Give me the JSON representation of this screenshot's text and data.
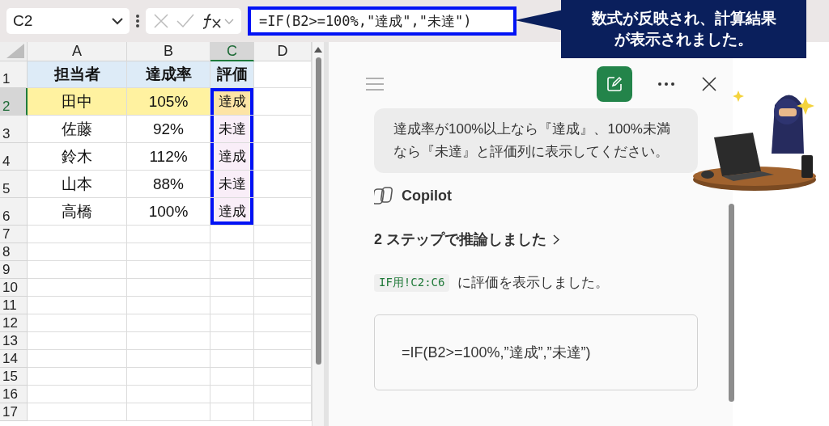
{
  "name_box": {
    "value": "C2"
  },
  "formula_bar": {
    "value": "=IF(B2>=100%,\"達成\",\"未達\")"
  },
  "callout": {
    "lines": [
      "数式が反映され、計算結果",
      "が表示されました。"
    ]
  },
  "sheet": {
    "columns": [
      {
        "label": "A",
        "selected": false
      },
      {
        "label": "B",
        "selected": false
      },
      {
        "label": "C",
        "selected": true
      },
      {
        "label": "D",
        "selected": false
      }
    ],
    "rows": [
      {
        "header": "1",
        "selected": false,
        "cells": [
          {
            "text": "担当者",
            "color": "#ddebf7",
            "bold": true
          },
          {
            "text": "達成率",
            "color": "#ddebf7",
            "bold": true
          },
          {
            "text": "評価",
            "color": "#ddebf7",
            "bold": true
          }
        ]
      },
      {
        "header": "2",
        "selected": true,
        "cells": [
          {
            "text": "田中",
            "color": "#fff2a0"
          },
          {
            "text": "105%",
            "color": "#fff2a0"
          },
          {
            "text": "達成",
            "color": "#fde4a6",
            "outlined": true
          }
        ]
      },
      {
        "header": "3",
        "selected": false,
        "cells": [
          {
            "text": "佐藤"
          },
          {
            "text": "92%"
          },
          {
            "text": "未達",
            "color": "#f9eef8",
            "outlined": true
          }
        ]
      },
      {
        "header": "4",
        "selected": false,
        "cells": [
          {
            "text": "鈴木"
          },
          {
            "text": "112%"
          },
          {
            "text": "達成",
            "color": "#f9eef8",
            "outlined": true
          }
        ]
      },
      {
        "header": "5",
        "selected": false,
        "cells": [
          {
            "text": "山本"
          },
          {
            "text": "88%"
          },
          {
            "text": "未達",
            "color": "#f9eef8",
            "outlined": true
          }
        ]
      },
      {
        "header": "6",
        "selected": false,
        "cells": [
          {
            "text": "高橋"
          },
          {
            "text": "100%"
          },
          {
            "text": "達成",
            "color": "#f9eef8",
            "outlined": true
          }
        ]
      },
      {
        "header": "7",
        "selected": false,
        "cells": []
      },
      {
        "header": "8",
        "selected": false,
        "cells": []
      },
      {
        "header": "9",
        "selected": false,
        "cells": []
      },
      {
        "header": "10",
        "selected": false,
        "cells": []
      },
      {
        "header": "11",
        "selected": false,
        "cells": []
      },
      {
        "header": "12",
        "selected": false,
        "cells": []
      },
      {
        "header": "13",
        "selected": false,
        "cells": []
      },
      {
        "header": "14",
        "selected": false,
        "cells": []
      },
      {
        "header": "15",
        "selected": false,
        "cells": []
      },
      {
        "header": "16",
        "selected": false,
        "cells": []
      },
      {
        "header": "17",
        "selected": false,
        "cells": []
      }
    ]
  },
  "copilot": {
    "user_message": "達成率が100%以上なら『達成』、100%未満なら『未達』と評価列に表示してください。",
    "assistant_name": "Copilot",
    "reasoning": "2 ステップで推論しました",
    "result": {
      "range": "IF用!C2:C6",
      "text": "に評価を表示しました。"
    },
    "code": "=IF(B2>=100%,”達成”,”未達”)"
  }
}
